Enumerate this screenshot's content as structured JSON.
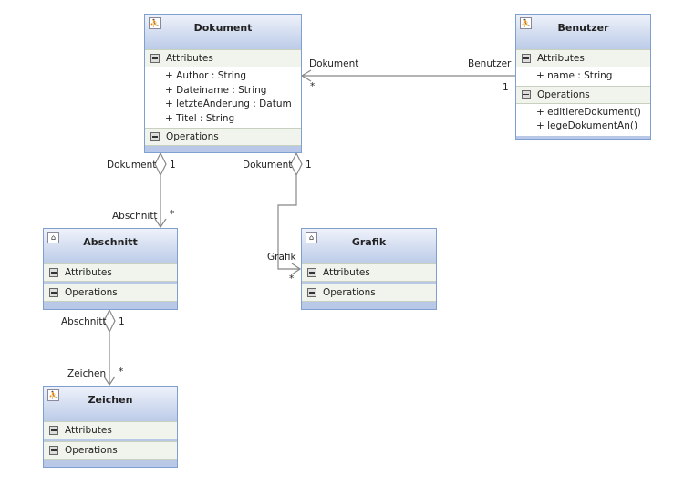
{
  "classes": {
    "dokument": {
      "name": "Dokument",
      "attributes_label": "Attributes",
      "operations_label": "Operations",
      "attributes": [
        "+ Author : String",
        "+ Dateiname : String",
        "+ letzteÄnderung : Datum",
        "+ Titel : String"
      ]
    },
    "benutzer": {
      "name": "Benutzer",
      "attributes_label": "Attributes",
      "operations_label": "Operations",
      "attributes": [
        "+ name : String"
      ],
      "operations": [
        "+ editiereDokument()",
        "+ legeDokumentAn()"
      ]
    },
    "abschnitt": {
      "name": "Abschnitt",
      "attributes_label": "Attributes",
      "operations_label": "Operations"
    },
    "grafik": {
      "name": "Grafik",
      "attributes_label": "Attributes",
      "operations_label": "Operations"
    },
    "zeichen": {
      "name": "Zeichen",
      "attributes_label": "Attributes",
      "operations_label": "Operations"
    }
  },
  "associations": [
    {
      "source_role": "Benutzer",
      "source_mult": "1",
      "target_role": "Dokument",
      "target_mult": "*"
    },
    {
      "source_role": "Dokument",
      "source_mult": "1",
      "target_role": "Abschnitt",
      "target_mult": "*"
    },
    {
      "source_role": "Dokument",
      "source_mult": "1",
      "target_role": "Grafik",
      "target_mult": "*"
    },
    {
      "source_role": "Abschnitt",
      "source_mult": "1",
      "target_role": "Zeichen",
      "target_mult": "*"
    }
  ]
}
